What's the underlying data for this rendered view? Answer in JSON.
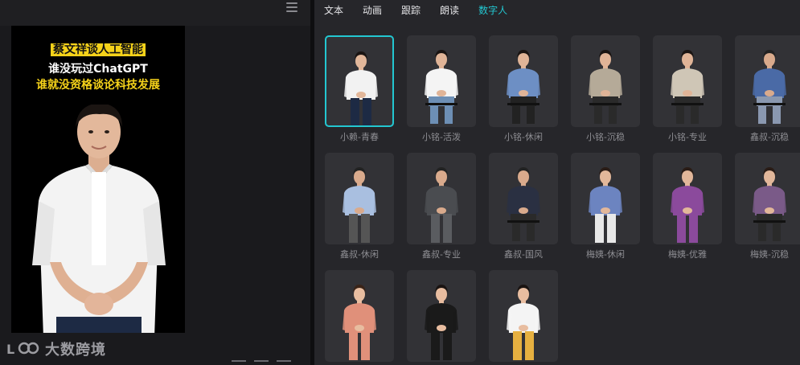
{
  "preview": {
    "caption_line1": "蔡文祥谈人工智能",
    "caption_line2": "谁没玩过ChatGPT",
    "caption_line3": "谁就没资格谈论科技发展",
    "watermark": "大数跨境"
  },
  "tabs": [
    {
      "label": "文本"
    },
    {
      "label": "动画"
    },
    {
      "label": "跟踪"
    },
    {
      "label": "朗读"
    },
    {
      "label": "数字人"
    }
  ],
  "active_tab": "数字人",
  "avatars": [
    {
      "label": "小赖-青春",
      "selected": true,
      "shirt": "#f2f2f2",
      "pants": "#1d2a44",
      "skin": "#e2b79a",
      "hair": "#1a1412",
      "seated": false
    },
    {
      "label": "小铭-活泼",
      "shirt": "#f4f4f4",
      "pants": "#6d8fb5",
      "skin": "#e0b497",
      "hair": "#1a1412",
      "seated": true
    },
    {
      "label": "小铭-休闲",
      "shirt": "#6d8fc4",
      "pants": "#222",
      "skin": "#e0b497",
      "hair": "#1a1412",
      "seated": true
    },
    {
      "label": "小铭-沉稳",
      "shirt": "#b5aa98",
      "pants": "#2a2a2a",
      "skin": "#e0b497",
      "hair": "#1a1412",
      "seated": true
    },
    {
      "label": "小铭-专业",
      "shirt": "#cfc6b6",
      "pants": "#2a2a2a",
      "skin": "#e0b497",
      "hair": "#1a1412",
      "seated": true
    },
    {
      "label": "鑫叔-沉稳",
      "shirt": "#4a6aa6",
      "pants": "#8a98b0",
      "skin": "#d9aa8c",
      "hair": "#222",
      "seated": true
    },
    {
      "label": "鑫叔-休闲",
      "shirt": "#a9bfe0",
      "pants": "#555",
      "skin": "#d9aa8c",
      "hair": "#222",
      "seated": false
    },
    {
      "label": "鑫叔-专业",
      "shirt": "#4a4c50",
      "pants": "#5a5c60",
      "skin": "#d9aa8c",
      "hair": "#222",
      "seated": false
    },
    {
      "label": "鑫叔-国风",
      "shirt": "#2a3042",
      "pants": "#2a2a2a",
      "skin": "#d9aa8c",
      "hair": "#222",
      "seated": true
    },
    {
      "label": "梅姨-休闲",
      "shirt": "#6c84c0",
      "pants": "#e8e8e8",
      "skin": "#e2b79a",
      "hair": "#2a1c16",
      "seated": false
    },
    {
      "label": "梅姨-优雅",
      "shirt": "#8b4a9c",
      "pants": "#8b4a9c",
      "skin": "#e2b79a",
      "hair": "#2a1c16",
      "seated": false
    },
    {
      "label": "梅姨-沉稳",
      "shirt": "#7a5a88",
      "pants": "#2a2a2a",
      "skin": "#e2b79a",
      "hair": "#2a1c16",
      "seated": true
    },
    {
      "label": "",
      "shirt": "#e0907a",
      "pants": "#e0907a",
      "skin": "#e8bda0",
      "hair": "#3a2418",
      "seated": false
    },
    {
      "label": "",
      "shirt": "#1a1a1a",
      "pants": "#1a1a1a",
      "skin": "#e8bda0",
      "hair": "#1a1412",
      "seated": false
    },
    {
      "label": "",
      "shirt": "#f4f4f4",
      "pants": "#e6b040",
      "skin": "#e8bda0",
      "hair": "#1a1412",
      "seated": false
    }
  ],
  "colors": {
    "accent": "#23c7d1",
    "caption_highlight": "#f5d21a"
  }
}
